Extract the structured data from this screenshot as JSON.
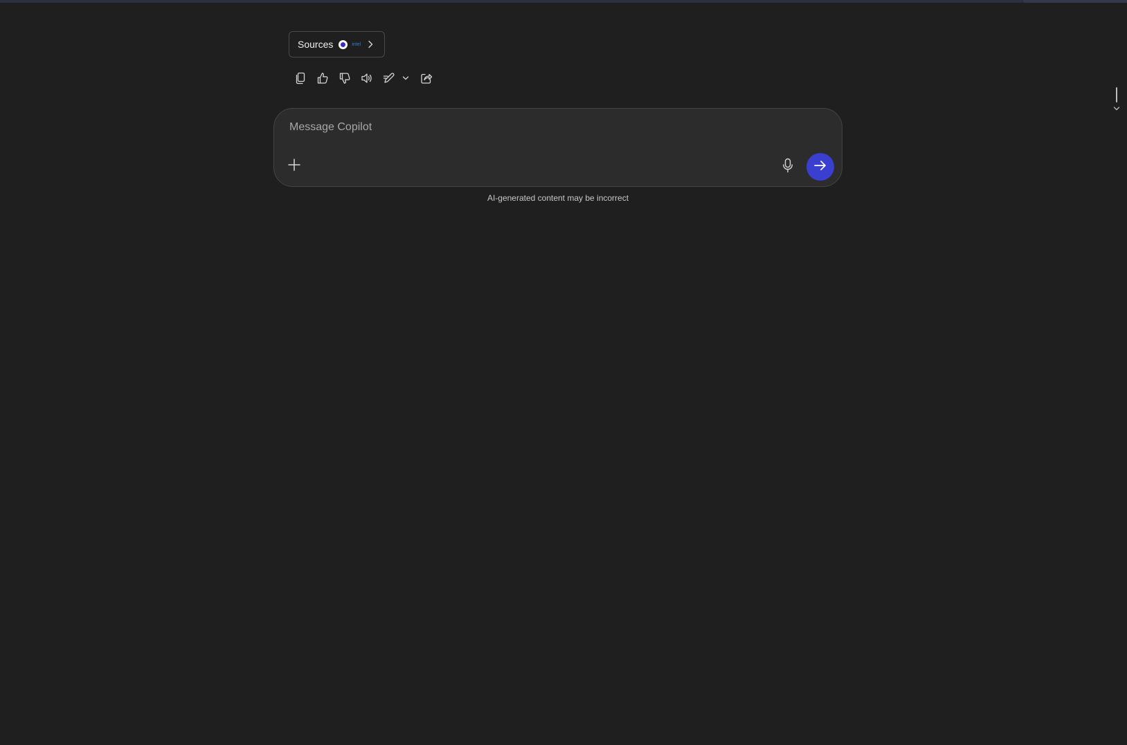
{
  "sources": {
    "label": "Sources",
    "favicon_icon": "source-favicon-icon",
    "brand_text": "intel"
  },
  "toolbar": {
    "icons": [
      "copy-icon",
      "thumbs-up-icon",
      "thumbs-down-icon",
      "speaker-icon",
      "edit-icon",
      "chevron-down-icon",
      "share-icon"
    ]
  },
  "composer": {
    "placeholder": "Message Copilot",
    "value": "",
    "accent_color": "#3a3fd0"
  },
  "disclaimer": "AI-generated content may be incorrect",
  "colors": {
    "background": "#1f1f1f",
    "composer_bg": "#2c2c2c",
    "send_button": "#3a3fd0"
  }
}
